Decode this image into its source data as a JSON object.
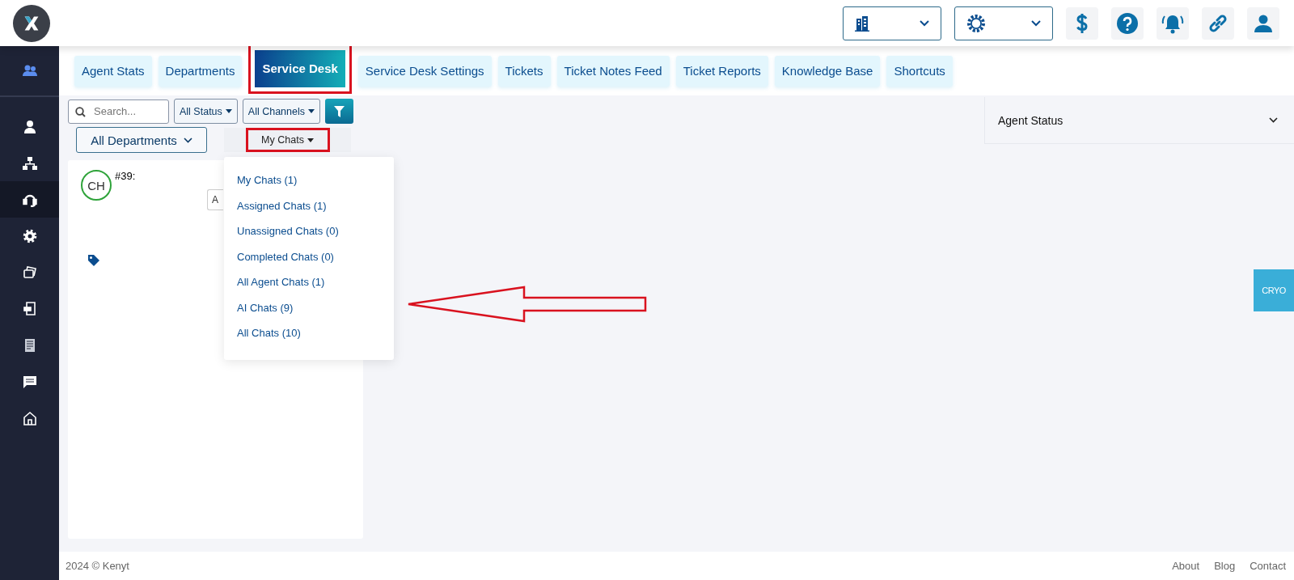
{
  "sidebar": {
    "items": [
      {
        "selected": false
      },
      {
        "selected": false
      },
      {
        "selected": false
      },
      {
        "selected": true
      },
      {
        "selected": false
      },
      {
        "selected": false
      },
      {
        "selected": false
      },
      {
        "selected": false
      },
      {
        "selected": false
      },
      {
        "selected": false
      }
    ]
  },
  "tabs": [
    {
      "label": "Agent Stats",
      "selected": false,
      "highlighted": false
    },
    {
      "label": "Departments",
      "selected": false,
      "highlighted": false
    },
    {
      "label": "Service Desk",
      "selected": true,
      "highlighted": true
    },
    {
      "label": "Service Desk Settings",
      "selected": false,
      "highlighted": false
    },
    {
      "label": "Tickets",
      "selected": false,
      "highlighted": false
    },
    {
      "label": "Ticket Notes Feed",
      "selected": false,
      "highlighted": false
    },
    {
      "label": "Ticket Reports",
      "selected": false,
      "highlighted": false
    },
    {
      "label": "Knowledge Base",
      "selected": false,
      "highlighted": false
    },
    {
      "label": "Shortcuts",
      "selected": false,
      "highlighted": false
    }
  ],
  "filters": {
    "search": {
      "placeholder": "Search..."
    },
    "status": "All Status",
    "channels": "All Channels",
    "department": "All Departments",
    "view": {
      "label": "My Chats",
      "highlighted": true,
      "expanded": true
    }
  },
  "view_menu": [
    "My Chats (1)",
    "Assigned Chats (1)",
    "Unassigned Chats (0)",
    "Completed Chats (0)",
    "All Agent Chats (1)",
    "AI Chats (9)",
    "All Chats (10)"
  ],
  "chats": [
    {
      "initials": "CH",
      "number": "#39:",
      "action": "A"
    }
  ],
  "agent_status": {
    "title": "Agent Status"
  },
  "badge": "CRYO",
  "footer": {
    "copyright": "2024 © Kenyt",
    "links": [
      "About",
      "Blog",
      "Contact"
    ]
  }
}
